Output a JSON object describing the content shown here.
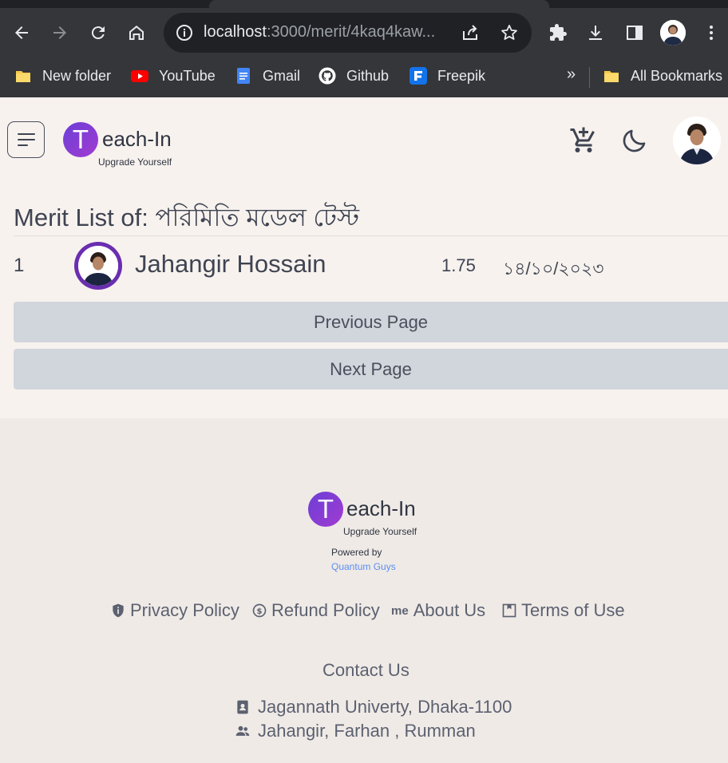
{
  "browser": {
    "url_host": "localhost",
    "url_rest": ":3000/merit/4kaq4kaw...",
    "bookmarks": [
      {
        "label": "New folder",
        "icon": "folder-icon"
      },
      {
        "label": "YouTube",
        "icon": "youtube-icon"
      },
      {
        "label": "Gmail",
        "icon": "docs-icon"
      },
      {
        "label": "Github",
        "icon": "github-icon"
      },
      {
        "label": "Freepik",
        "icon": "freepik-icon"
      }
    ],
    "more": "»",
    "all_bookmarks": "All Bookmarks"
  },
  "header": {
    "logo_letter": "T",
    "logo_word": "each-In",
    "tagline": "Upgrade Yourself"
  },
  "page": {
    "title": "Merit List of: পরিমিতি মডেল টেস্ট"
  },
  "merit": [
    {
      "rank": "1",
      "name": "Jahangir Hossain",
      "score": "1.75",
      "date": "১৪/১০/২০২৩"
    }
  ],
  "pagination": {
    "previous": "Previous Page",
    "next": "Next Page"
  },
  "footer": {
    "logo_letter": "T",
    "logo_word": "each-In",
    "tagline": "Upgrade Yourself",
    "powered_by": "Powered by",
    "company": "Quantum Guys",
    "links": {
      "privacy": "Privacy Policy",
      "refund": "Refund Policy",
      "about_prefix": "me",
      "about": "About Us",
      "terms": "Terms of Use"
    },
    "contact_title": "Contact Us",
    "address": "Jagannath Univerty, Dhaka-1100",
    "people": "Jahangir, Farhan , Rumman"
  },
  "colors": {
    "brand_purple": "#7b3fd8",
    "avatar_ring": "#6a2eb0",
    "button_bg": "#d1d5dc",
    "link_blue": "#5b8ff2"
  }
}
